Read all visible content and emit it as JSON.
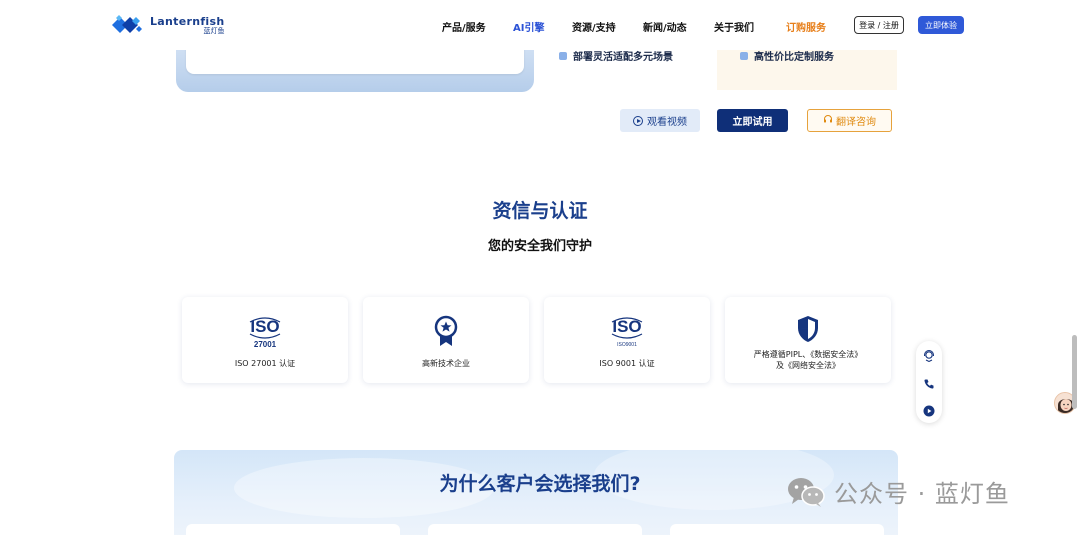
{
  "brand": {
    "name_en": "Lanternfish",
    "name_cn": "蓝灯鱼",
    "primary_color": "#1a3f8c",
    "accent_color": "#2f59d8",
    "order_color": "#e77f1a"
  },
  "nav": {
    "items": [
      {
        "label": "产品/服务"
      },
      {
        "label": "AI引擎"
      },
      {
        "label": "资源/支持"
      },
      {
        "label": "新闻/动态"
      },
      {
        "label": "关于我们"
      },
      {
        "label": "订购服务"
      }
    ],
    "login_label": "登录 / 注册",
    "try_label": "立即体验"
  },
  "prev_section": {
    "feature_left": "部署灵活适配多元场景",
    "feature_right": "高性价比定制服务"
  },
  "actions": {
    "video_label": "观看视频",
    "try_label": "立即试用",
    "consult_label": "翻译咨询"
  },
  "certification": {
    "title": "资信与认证",
    "subtitle": "您的安全我们守护",
    "cards": [
      {
        "icon": "iso-27001-icon",
        "icon_text": "ISO",
        "icon_sub": "27001",
        "label": "ISO 27001 认证"
      },
      {
        "icon": "award-ribbon-icon",
        "label": "高新技术企业"
      },
      {
        "icon": "iso-9001-icon",
        "icon_text": "ISO",
        "icon_sub": "ISO9001",
        "label": "ISO 9001 认证"
      },
      {
        "icon": "shield-icon",
        "label_line1": "严格遵循PIPL、《数据安全法》",
        "label_line2": "及《网络安全法》"
      }
    ]
  },
  "side_widget": {
    "icons": [
      "customer-service-icon",
      "phone-icon",
      "play-icon"
    ]
  },
  "why_section": {
    "title": "为什么客户会选择我们?"
  },
  "watermark": {
    "text": "公众号 · 蓝灯鱼"
  }
}
